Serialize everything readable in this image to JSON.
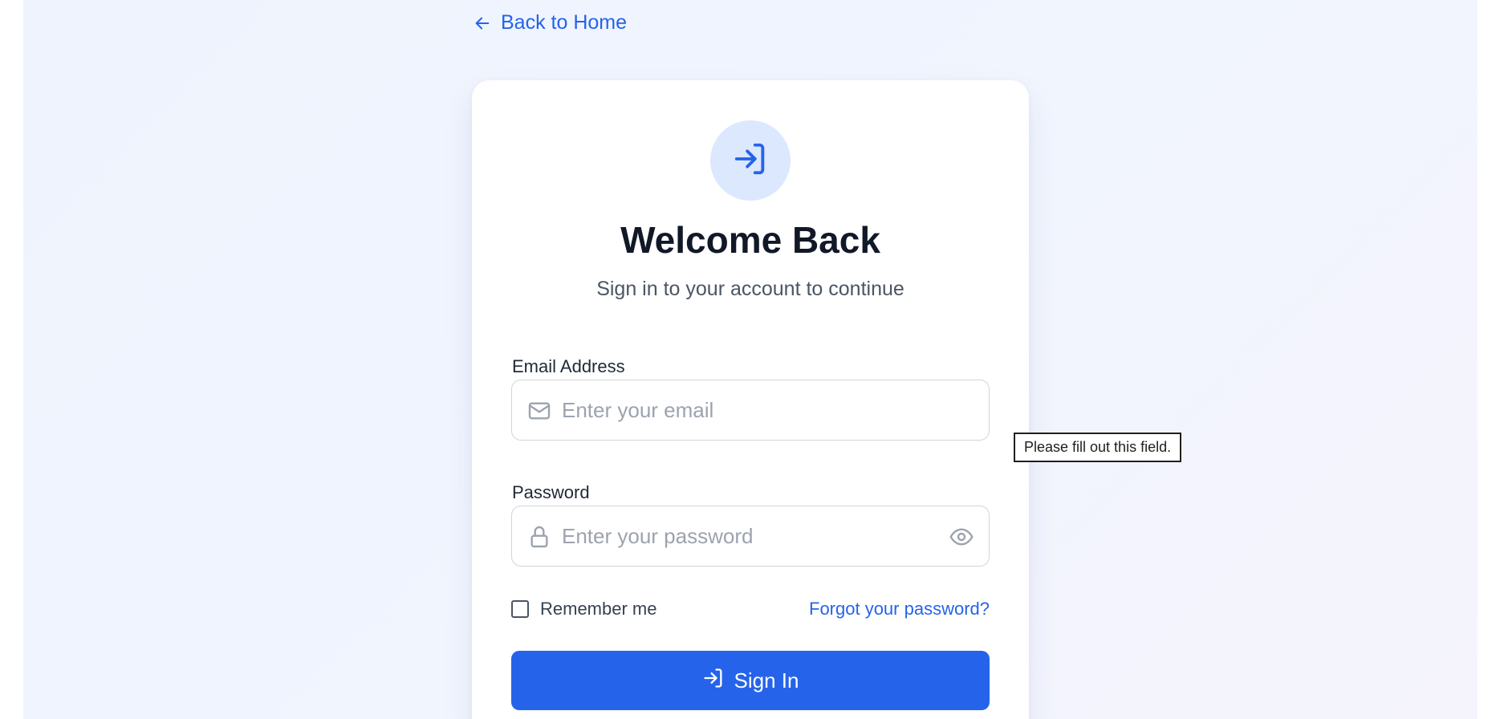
{
  "nav": {
    "back_label": "Back to Home"
  },
  "header": {
    "title": "Welcome Back",
    "subtitle": "Sign in to your account to continue"
  },
  "form": {
    "email": {
      "label": "Email Address",
      "value": "",
      "placeholder": "Enter your email",
      "icon": "mail-icon"
    },
    "password": {
      "label": "Password",
      "value": "",
      "placeholder": "Enter your password",
      "icon": "lock-icon",
      "toggle_icon": "eye-icon"
    },
    "remember_label": "Remember me",
    "remember_checked": false,
    "forgot_label": "Forgot your password?",
    "submit_label": "Sign In",
    "validation_tooltip": "Please fill out this field."
  },
  "colors": {
    "accent": "#2563eb",
    "icon_circle_bg": "#dbe8fe",
    "title": "#111827",
    "muted_text": "#4b5563",
    "placeholder": "#9ca3af"
  }
}
